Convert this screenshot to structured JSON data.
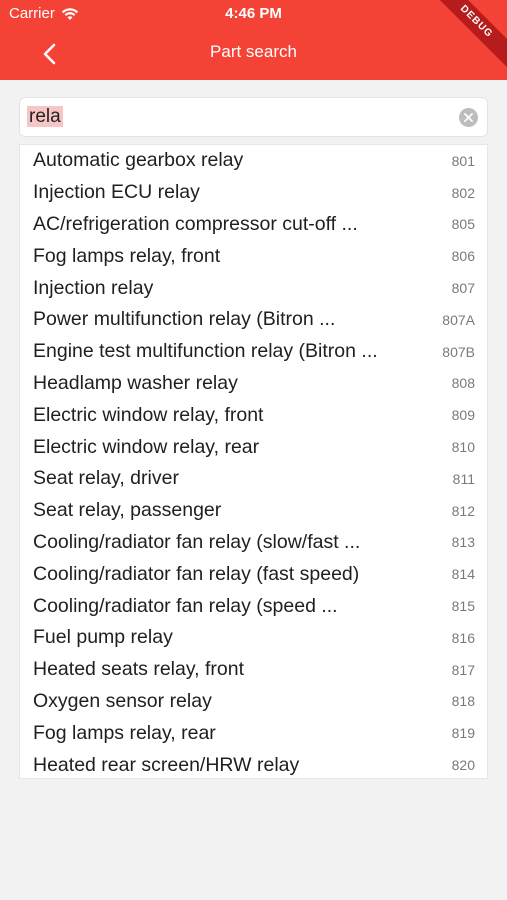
{
  "status": {
    "carrier": "Carrier",
    "time": "4:46 PM"
  },
  "debug_label": "DEBUG",
  "appbar": {
    "title": "Part search"
  },
  "search": {
    "value": "rela"
  },
  "results": [
    {
      "name": "Automatic gearbox relay",
      "code": "801"
    },
    {
      "name": "Injection ECU relay",
      "code": "802"
    },
    {
      "name": "AC/refrigeration compressor cut-off ...",
      "code": "805"
    },
    {
      "name": "Fog lamps relay, front",
      "code": "806"
    },
    {
      "name": "Injection relay",
      "code": "807"
    },
    {
      "name": "Power multifunction relay (Bitron ...",
      "code": "807A"
    },
    {
      "name": "Engine test multifunction relay (Bitron ...",
      "code": "807B"
    },
    {
      "name": "Headlamp washer relay",
      "code": "808"
    },
    {
      "name": "Electric window relay, front",
      "code": "809"
    },
    {
      "name": "Electric window relay, rear",
      "code": "810"
    },
    {
      "name": "Seat relay, driver",
      "code": "811"
    },
    {
      "name": "Seat relay, passenger",
      "code": "812"
    },
    {
      "name": "Cooling/radiator fan relay (slow/fast ...",
      "code": "813"
    },
    {
      "name": "Cooling/radiator fan relay (fast speed)",
      "code": "814"
    },
    {
      "name": "Cooling/radiator fan relay (speed ...",
      "code": "815"
    },
    {
      "name": "Fuel pump relay",
      "code": "816"
    },
    {
      "name": "Heated seats relay, front",
      "code": "817"
    },
    {
      "name": "Oxygen sensor relay",
      "code": "818"
    },
    {
      "name": "Fog lamps relay, rear",
      "code": "819"
    },
    {
      "name": "Heated rear screen/HRW relay",
      "code": "820"
    }
  ],
  "colors": {
    "appbar": "#f44336",
    "highlight": "#f7c6c4"
  },
  "icons": {
    "back": "chevron-left-icon",
    "clear": "clear-circle-icon",
    "wifi": "wifi-icon"
  }
}
